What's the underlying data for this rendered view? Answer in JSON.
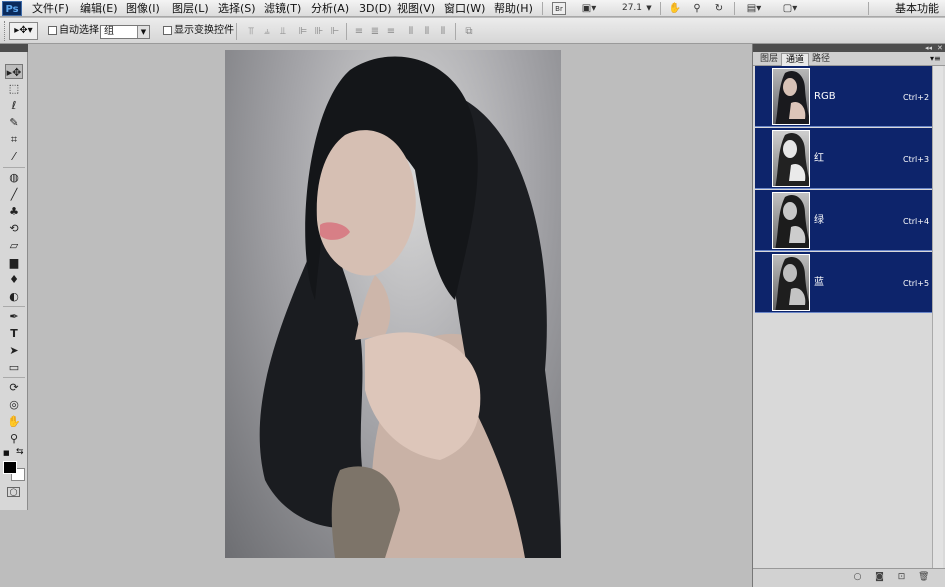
{
  "app": {
    "logo": "Ps"
  },
  "menu": [
    "文件(F)",
    "编辑(E)",
    "图像(I)",
    "图层(L)",
    "选择(S)",
    "滤镜(T)",
    "分析(A)",
    "3D(D)",
    "视图(V)",
    "窗口(W)",
    "帮助(H)"
  ],
  "menubar": {
    "zoom": "27.1",
    "workspace": "基本功能"
  },
  "options": {
    "auto_select_label": "自动选择:",
    "auto_select_value": "组",
    "show_transform_label": "显示变换控件"
  },
  "tools": [
    "move-tool",
    "marquee-tool",
    "lasso-tool",
    "quick-select-tool",
    "crop-tool",
    "eyedropper-tool",
    "healing-brush-tool",
    "brush-tool",
    "clone-stamp-tool",
    "history-brush-tool",
    "eraser-tool",
    "gradient-tool",
    "blur-tool",
    "dodge-tool",
    "pen-tool",
    "type-tool",
    "path-selection-tool",
    "shape-tool",
    "3d-rotate-tool",
    "3d-orbit-tool",
    "hand-tool",
    "zoom-tool"
  ],
  "panel": {
    "tabs": [
      "图层",
      "通道",
      "路径"
    ],
    "active_tab": 1,
    "channels": [
      {
        "name": "RGB",
        "shortcut": "Ctrl+2"
      },
      {
        "name": "红",
        "shortcut": "Ctrl+3"
      },
      {
        "name": "绿",
        "shortcut": "Ctrl+4"
      },
      {
        "name": "蓝",
        "shortcut": "Ctrl+5"
      }
    ]
  },
  "colors": {
    "channel_row_selected": "#0d246b",
    "canvas_bg": "#bdbdbd",
    "panel_bg": "#d9d9d9"
  }
}
